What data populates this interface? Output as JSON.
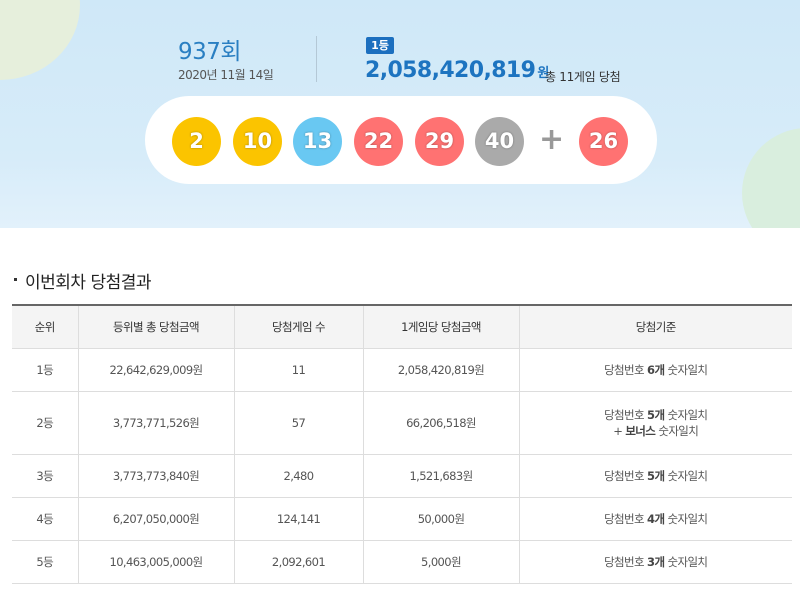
{
  "draw": {
    "round_number": "937",
    "round_unit": "회",
    "date": "2020년 11월 14일"
  },
  "first_prize": {
    "badge": "1등",
    "amount": "2,058,420,819",
    "unit": "원",
    "winners_text": "총 11게임 당첨"
  },
  "balls": [
    {
      "number": "2",
      "color": "#fbc400"
    },
    {
      "number": "10",
      "color": "#fbc400"
    },
    {
      "number": "13",
      "color": "#69c8f2"
    },
    {
      "number": "22",
      "color": "#ff7272"
    },
    {
      "number": "29",
      "color": "#ff7272"
    },
    {
      "number": "40",
      "color": "#aaaaaa"
    }
  ],
  "plus_symbol": "+",
  "bonus_ball": {
    "number": "26",
    "color": "#ff7272"
  },
  "section_title": "이번회차 당첨결과",
  "table": {
    "headers": [
      "순위",
      "등위별 총 당첨금액",
      "당첨게임 수",
      "1게임당 당첨금액",
      "당첨기준"
    ],
    "rows": [
      {
        "rank": "1등",
        "total": "22,642,629,009원",
        "games": "11",
        "per_game": "2,058,420,819원",
        "criteria": {
          "pre": "당첨번호 ",
          "bold": "6개",
          "post": " 숫자일치"
        }
      },
      {
        "rank": "2등",
        "total": "3,773,771,526원",
        "games": "57",
        "per_game": "66,206,518원",
        "criteria": {
          "pre": "당첨번호 ",
          "bold": "5개",
          "post": " 숫자일치",
          "line2_pre": "+ ",
          "line2_bold": "보너스",
          "line2_post": " 숫자일치"
        }
      },
      {
        "rank": "3등",
        "total": "3,773,773,840원",
        "games": "2,480",
        "per_game": "1,521,683원",
        "criteria": {
          "pre": "당첨번호 ",
          "bold": "5개",
          "post": " 숫자일치"
        }
      },
      {
        "rank": "4등",
        "total": "6,207,050,000원",
        "games": "124,141",
        "per_game": "50,000원",
        "criteria": {
          "pre": "당첨번호 ",
          "bold": "4개",
          "post": " 숫자일치"
        }
      },
      {
        "rank": "5등",
        "total": "10,463,005,000원",
        "games": "2,092,601",
        "per_game": "5,000원",
        "criteria": {
          "pre": "당첨번호 ",
          "bold": "3개",
          "post": " 숫자일치"
        }
      }
    ]
  }
}
